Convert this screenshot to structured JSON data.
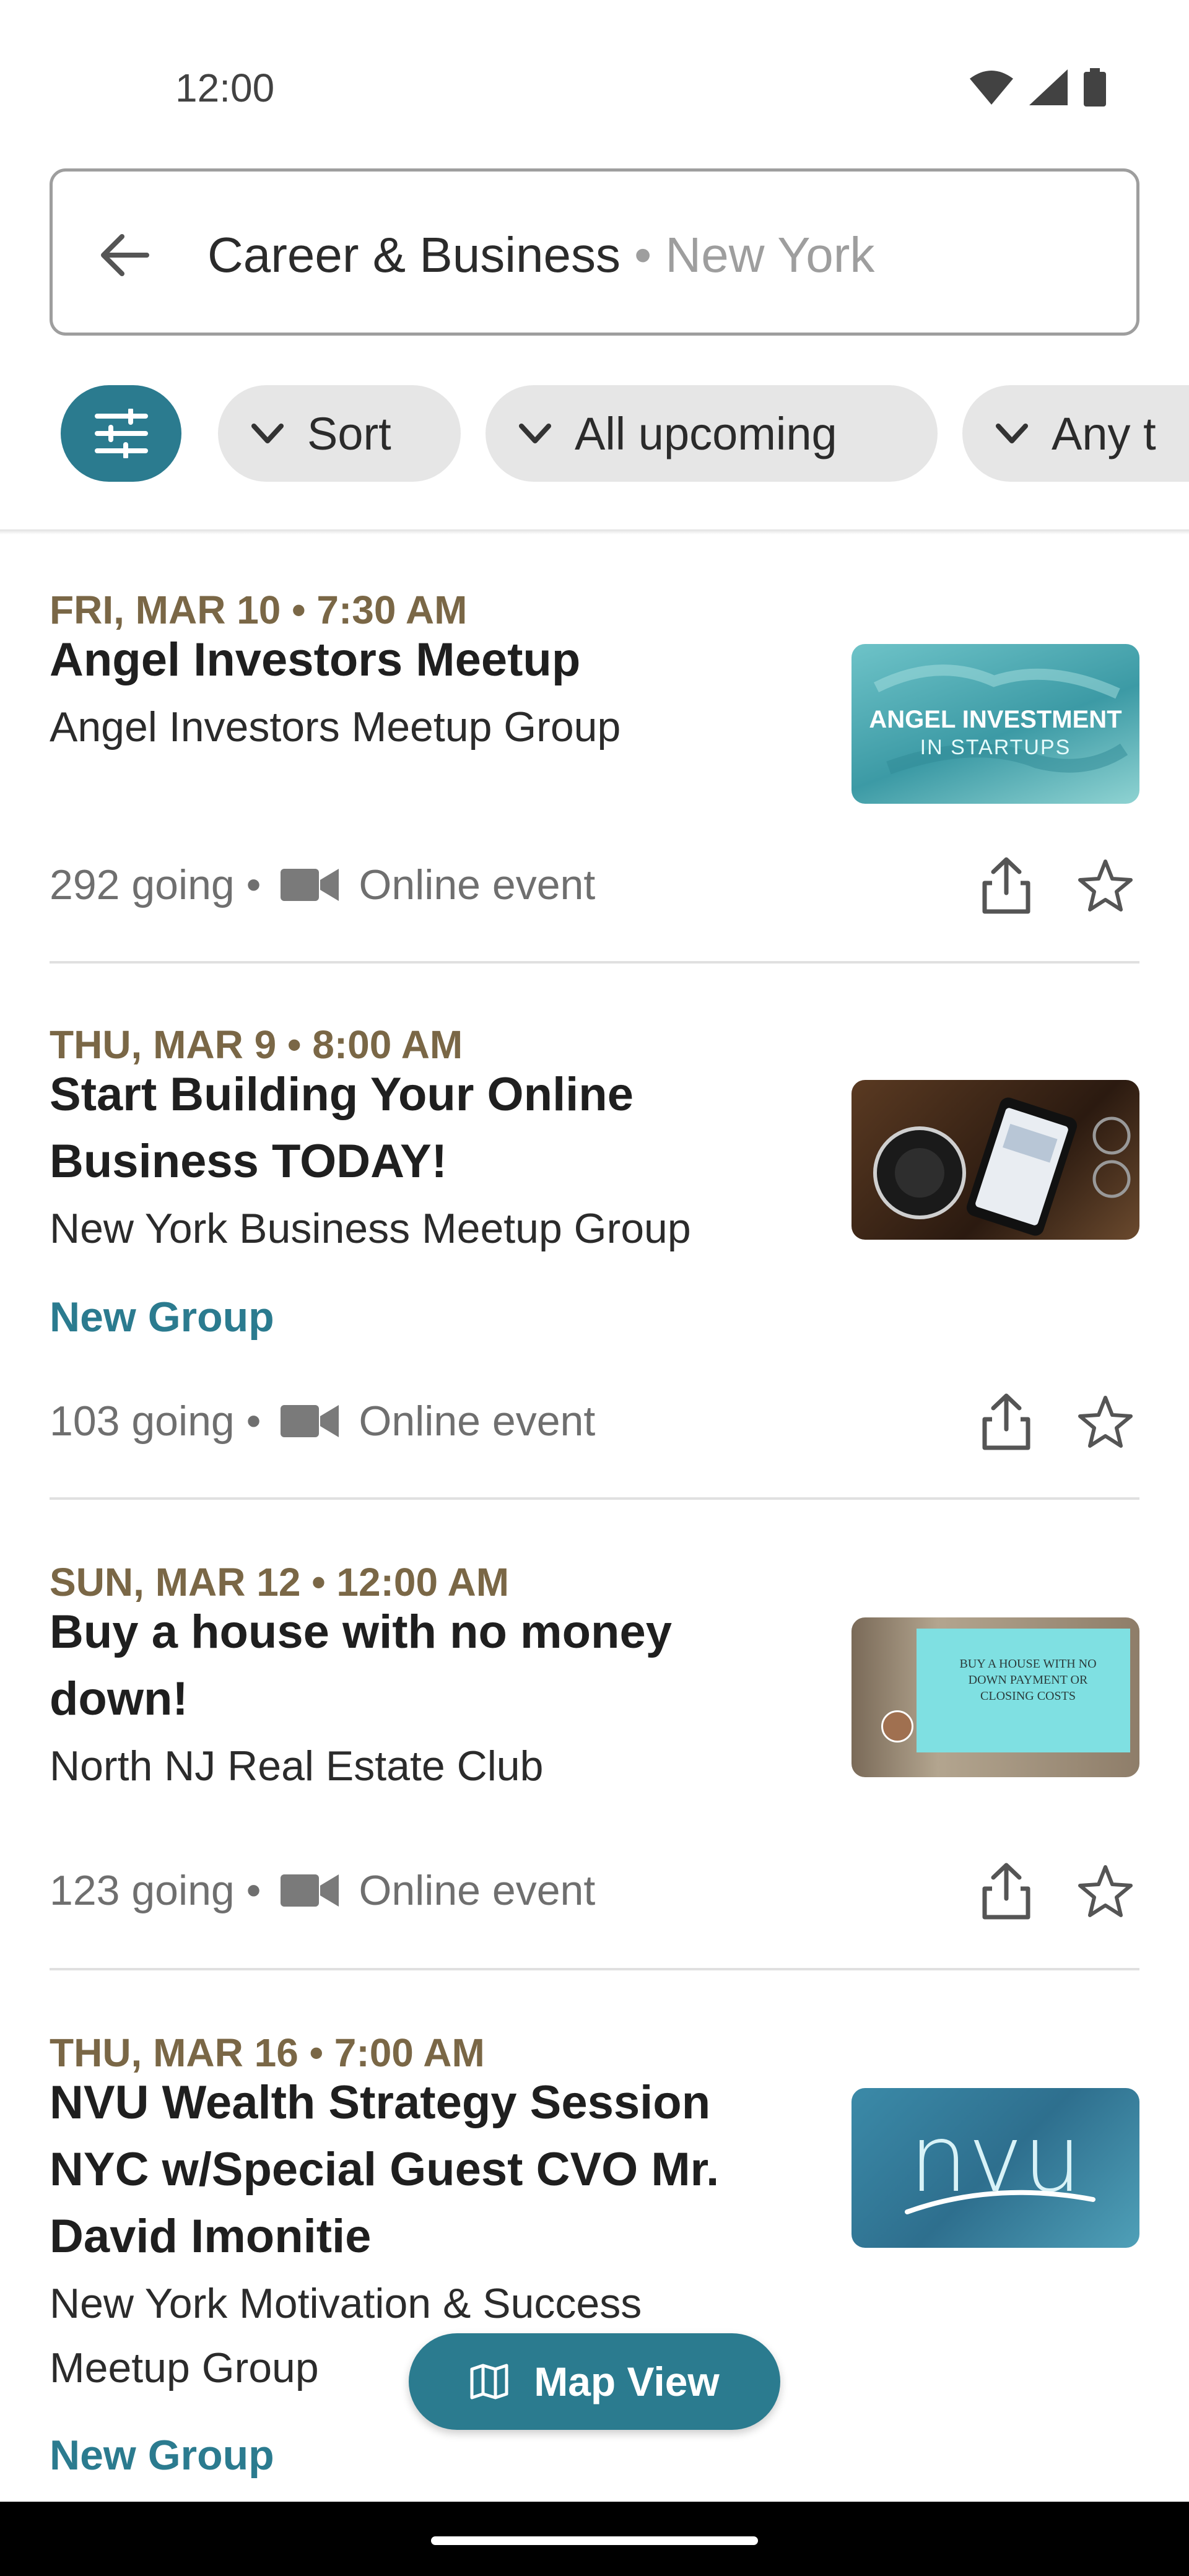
{
  "status_bar": {
    "time": "12:00"
  },
  "search": {
    "category": "Career & Business",
    "separator": " • ",
    "location": "New York"
  },
  "chips": {
    "sort": "Sort",
    "upcoming": "All upcoming",
    "any": "Any t"
  },
  "events": [
    {
      "date": "FRI, MAR 10 • 7:30 AM",
      "title": "Angel Investors Meetup",
      "group": "Angel Investors Meetup Group",
      "new_group": "",
      "going": "292 going",
      "location_type": "Online event",
      "thumb_text_1": "ANGEL INVESTMENT",
      "thumb_text_2": "IN STARTUPS"
    },
    {
      "date": "THU, MAR 9 • 8:00 AM",
      "title": "Start Building Your Online Business TODAY!",
      "group": "New York Business Meetup Group",
      "new_group": "New Group",
      "going": "103 going",
      "location_type": "Online event"
    },
    {
      "date": "SUN, MAR 12 • 12:00 AM",
      "title": "Buy a house with no money down!",
      "group": "North NJ Real Estate Club",
      "new_group": "",
      "going": "123 going",
      "location_type": "Online event",
      "thumb_text_1": "BUY A HOUSE WITH NO DOWN PAYMENT OR CLOSING COSTS"
    },
    {
      "date": "THU, MAR 16 • 7:00 AM",
      "title": "NVU Wealth Strategy Session NYC w/Special Guest CVO Mr. David Imonitie",
      "group": "New York Motivation & Success Meetup Group",
      "new_group": "New Group",
      "going": "",
      "location_type": "",
      "thumb_text_1": "nvu"
    }
  ],
  "map_button": {
    "label": "Map View"
  },
  "colors": {
    "accent": "#2b7b8f",
    "date": "#7a6746",
    "chip_bg": "#e6e6e6"
  }
}
